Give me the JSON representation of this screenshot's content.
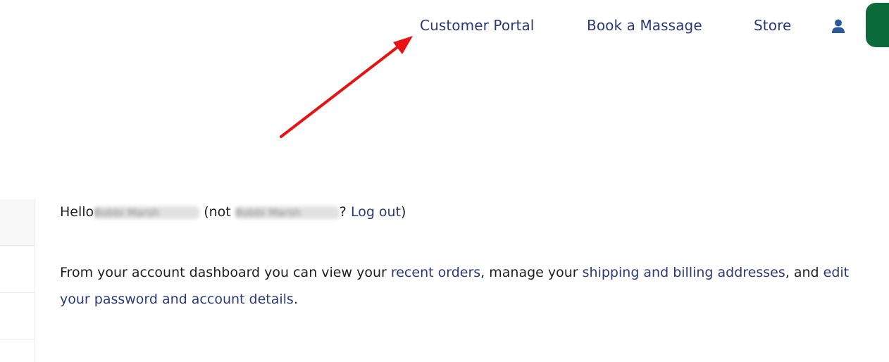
{
  "nav": {
    "customer_portal": "Customer Portal",
    "book_massage": "Book a Massage",
    "store": "Store"
  },
  "colors": {
    "link": "#2a3a78",
    "brand_green": "#0b6a3a",
    "annotation_arrow": "#e81212"
  },
  "icons": {
    "account": "user-icon"
  },
  "greeting": {
    "hello": "Hello",
    "name_redacted": "Bobbi Marsh",
    "not_prefix": "(not",
    "question": "?",
    "logout": "Log out",
    "close_paren": ")"
  },
  "dashboard": {
    "text1": "From your account dashboard you can view your",
    "recent_orders": "recent orders",
    "text2": ", manage your",
    "shipping_billing": "shipping and billing addresses",
    "text3": ", and",
    "edit_details": "edit your password and account details",
    "text4": "."
  }
}
